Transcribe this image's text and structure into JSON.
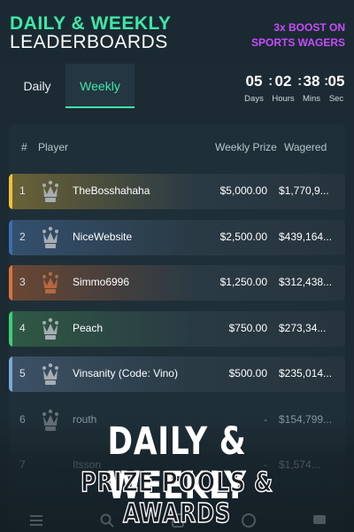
{
  "header": {
    "title_line1": "DAILY & WEEKLY",
    "title_line2": "LEADERBOARDS",
    "boost_line1": "3x BOOST ON",
    "boost_line2": "SPORTS WAGERS"
  },
  "tabs": [
    {
      "label": "Daily",
      "active": false
    },
    {
      "label": "Weekly",
      "active": true
    }
  ],
  "countdown": {
    "days": "05",
    "days_label": "Days",
    "hours": "02",
    "hours_label": "Hours",
    "mins": "38",
    "mins_label": "Mins",
    "secs": "05",
    "secs_label": "Sec",
    "separator": ":"
  },
  "table": {
    "headers": {
      "rank": "#",
      "player": "Player",
      "prize": "Weekly Prize",
      "wagered": "Wagered"
    },
    "rows": [
      {
        "rank": "1",
        "player": "TheBosshahaha",
        "prize": "$5,000.00",
        "wagered": "$1,770,9...",
        "icon": "crown-icon",
        "accent": "#f0c23a",
        "tint": "#6b6236"
      },
      {
        "rank": "2",
        "player": "NiceWebsite",
        "prize": "$2,500.00",
        "wagered": "$439,164...",
        "icon": "crown-icon",
        "accent": "#3a6fb0",
        "tint": "#34506e"
      },
      {
        "rank": "3",
        "player": "Simmo6996",
        "prize": "$1,250.00",
        "wagered": "$312,438...",
        "icon": "bronze-crown-icon",
        "accent": "#d9743a",
        "tint": "#6a4634"
      },
      {
        "rank": "4",
        "player": "Peach",
        "prize": "$750.00",
        "wagered": "$273,34...",
        "icon": "crown-icon",
        "accent": "#3ccf77",
        "tint": "#2f5943"
      },
      {
        "rank": "5",
        "player": "Vinsanity (Code: Vino)",
        "prize": "$500.00",
        "wagered": "$235,014...",
        "icon": "crown-icon",
        "accent": "#7aa7d6",
        "tint": "#3c5266"
      },
      {
        "rank": "6",
        "player": "routh",
        "prize": "-",
        "wagered": "$154,799...",
        "icon": "crown-icon"
      },
      {
        "rank": "7",
        "player": "Itsson",
        "prize": "-",
        "wagered": "$1,574..."
      }
    ]
  },
  "promo": {
    "line1": "DAILY & WEEKLY",
    "line2": "PRIZE POOLS & AWARDS"
  },
  "bottom_nav": [
    {
      "icon": "menu-icon"
    },
    {
      "icon": "search-icon"
    },
    {
      "icon": "casino-icon"
    },
    {
      "icon": "sports-ball-icon"
    },
    {
      "icon": "chat-icon"
    }
  ]
}
